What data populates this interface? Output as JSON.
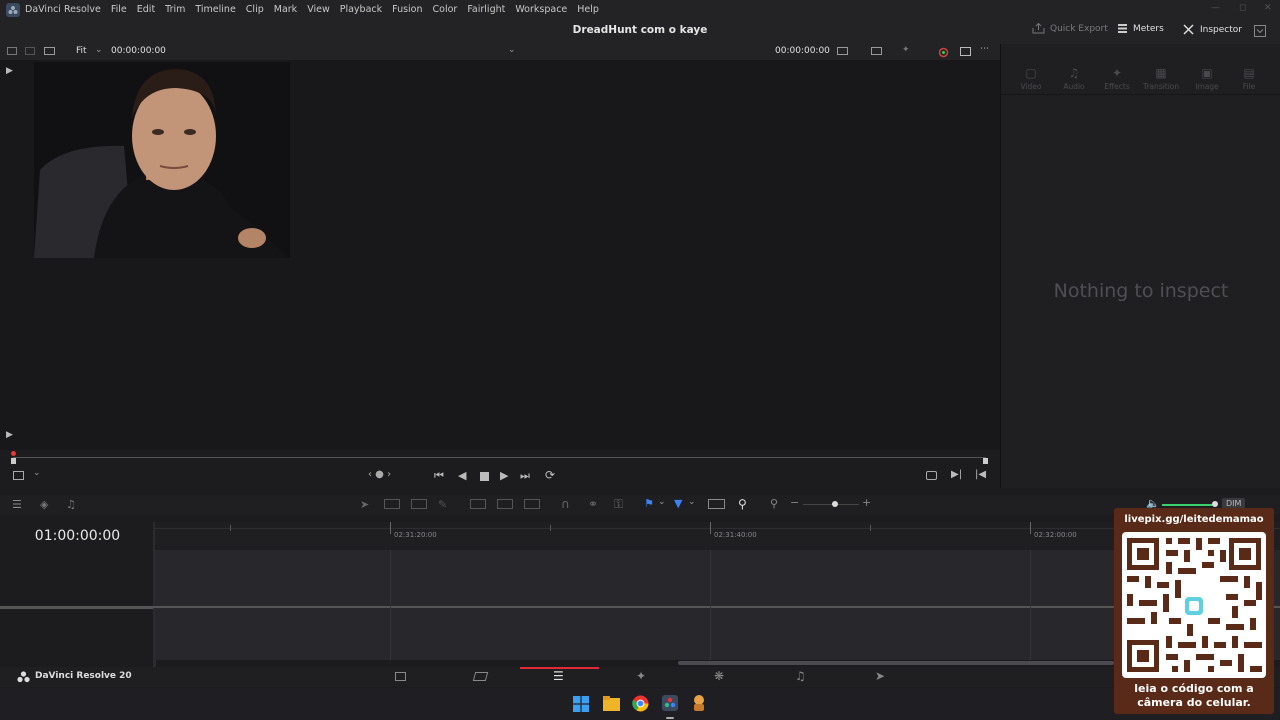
{
  "app": {
    "name": "DaVinci Resolve",
    "menu": [
      "File",
      "Edit",
      "Trim",
      "Timeline",
      "Clip",
      "Mark",
      "View",
      "Playback",
      "Fusion",
      "Color",
      "Fairlight",
      "Workspace",
      "Help"
    ],
    "project_title": "DreadHunt com o kaye",
    "quick_export": "Quick Export",
    "meters": "Meters",
    "inspector": "Inspector"
  },
  "viewer": {
    "zoom": "Fit",
    "source_timecode": "00:00:00:00",
    "record_timecode": "00:00:00:00"
  },
  "inspector_panel": {
    "tabs": [
      "Video",
      "Audio",
      "Effects",
      "Transition",
      "Image",
      "File"
    ],
    "empty_message": "Nothing to inspect"
  },
  "timeline": {
    "timecode": "01:00:00:00",
    "ruler_marks": [
      "02:31:20:00",
      "02:31:40:00",
      "02:32:00:00"
    ],
    "dim_label": "DIM"
  },
  "footer": {
    "version_label": "DaVinci Resolve 20"
  },
  "overlay": {
    "url": "livepix.gg/leitedemamao",
    "caption_line1": "leia o código com a",
    "caption_line2": "câmera do celular."
  }
}
